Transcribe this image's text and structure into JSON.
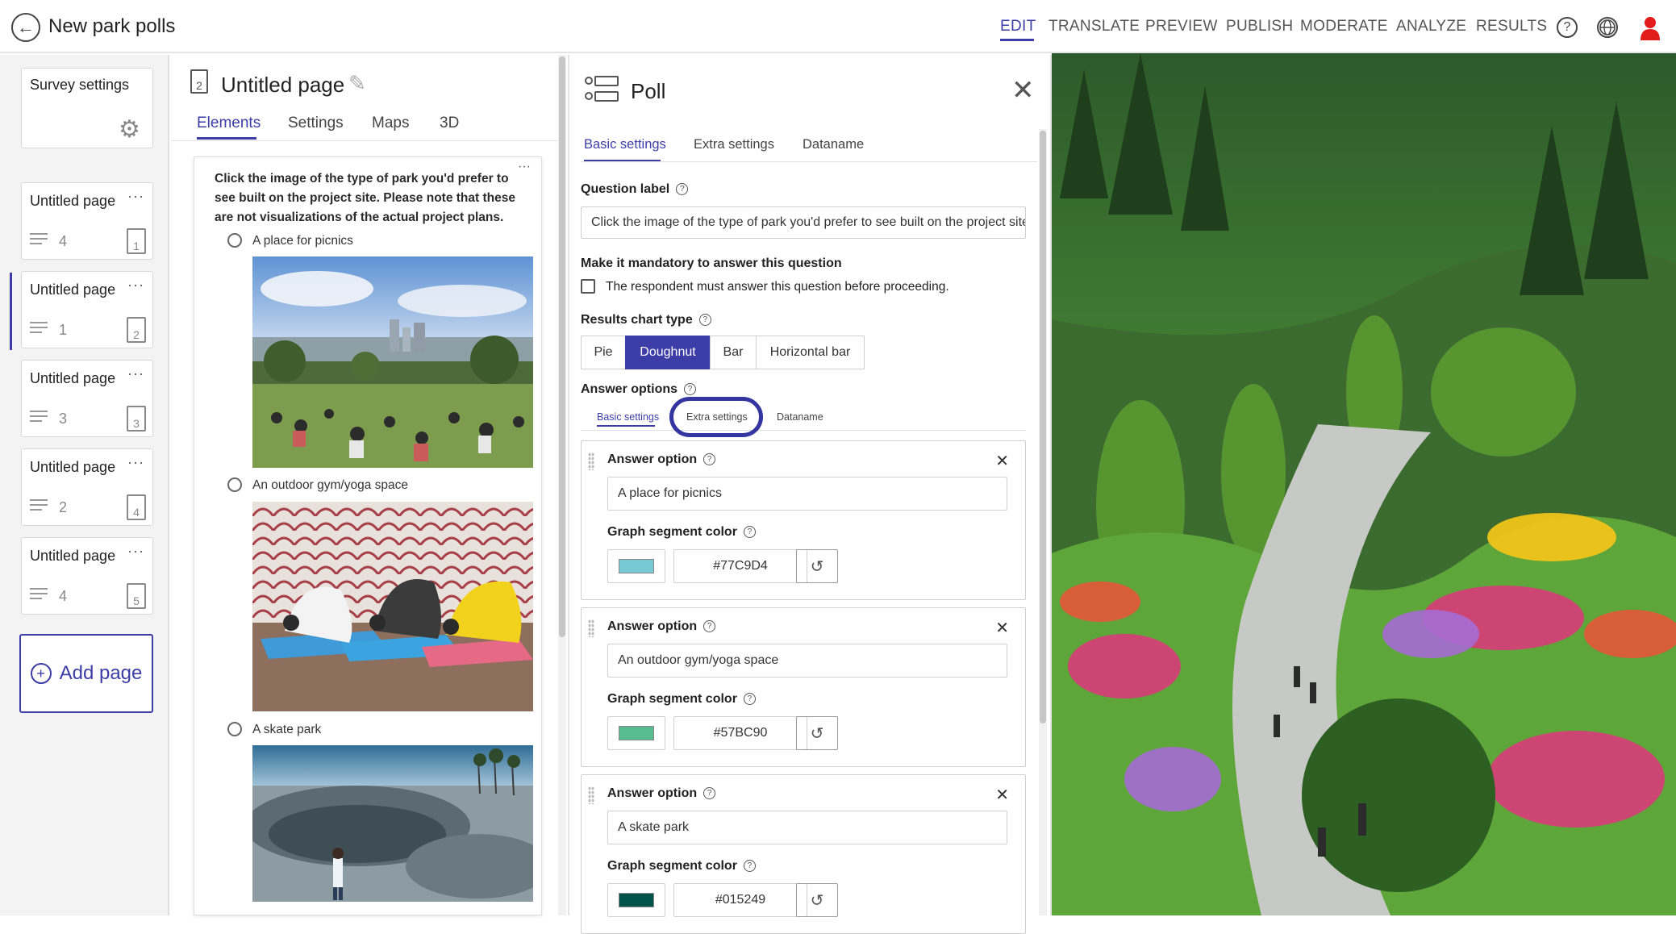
{
  "header": {
    "title": "New park polls",
    "nav": [
      "EDIT",
      "TRANSLATE",
      "PREVIEW",
      "PUBLISH",
      "MODERATE",
      "ANALYZE",
      "RESULTS"
    ],
    "active_nav": "EDIT"
  },
  "sidebar": {
    "survey_settings_label": "Survey settings",
    "pages": [
      {
        "title": "Untitled page",
        "count": "4",
        "number": "1"
      },
      {
        "title": "Untitled page",
        "count": "1",
        "number": "2"
      },
      {
        "title": "Untitled page",
        "count": "3",
        "number": "3"
      },
      {
        "title": "Untitled page",
        "count": "2",
        "number": "4"
      },
      {
        "title": "Untitled page",
        "count": "4",
        "number": "5"
      }
    ],
    "more_glyph": "···",
    "add_page_label": "Add page"
  },
  "editor": {
    "page_number": "2",
    "page_title": "Untitled page",
    "tabs": [
      "Elements",
      "Settings",
      "Maps",
      "3D"
    ],
    "active_tab": "Elements",
    "question": "Click the image of the type of park you'd prefer to see built on the project site. Please note that these are not visualizations of the actual project plans.",
    "options": [
      "A place for picnics",
      "An outdoor gym/yoga space",
      "A skate park"
    ]
  },
  "panel": {
    "title": "Poll",
    "tabs": [
      "Basic settings",
      "Extra settings",
      "Dataname"
    ],
    "question_label_title": "Question label",
    "question_label_value": "Click the image of the type of park you'd prefer to see built on the project site. Please note that these are not visualizations of the actual project plans.",
    "mandatory_title": "Make it mandatory to answer this question",
    "mandatory_checkbox_label": "The respondent must answer this question before proceeding.",
    "chart_type_title": "Results chart type",
    "chart_types": [
      "Pie",
      "Doughnut",
      "Bar",
      "Horizontal bar"
    ],
    "chart_type_selected": "Doughnut",
    "answer_options_title": "Answer options",
    "answer_tabs": [
      "Basic settings",
      "Extra settings",
      "Dataname"
    ],
    "answer_option_label": "Answer option",
    "segment_color_label": "Graph segment color",
    "answers": [
      {
        "value": "A place for picnics",
        "color": "#77C9D4"
      },
      {
        "value": "An outdoor gym/yoga space",
        "color": "#57BC90"
      },
      {
        "value": "A skate park",
        "color": "#015249"
      }
    ]
  },
  "colors": {
    "accent": "#3d3da8"
  }
}
